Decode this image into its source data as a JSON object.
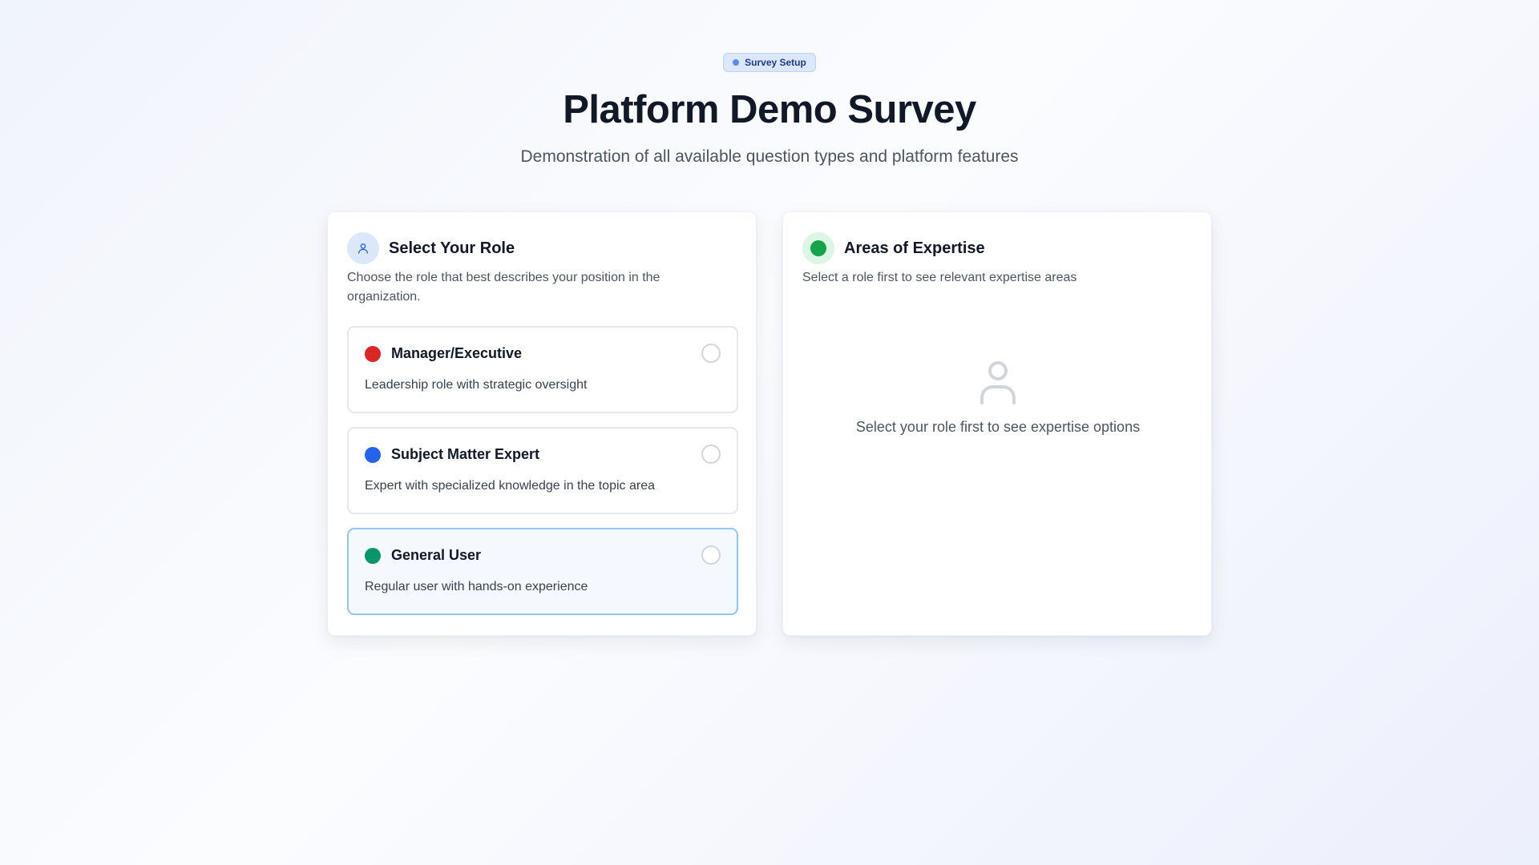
{
  "header": {
    "badge_label": "Survey Setup",
    "title": "Platform Demo Survey",
    "subtitle": "Demonstration of all available question types and platform features"
  },
  "role_card": {
    "icon": "user-icon",
    "title": "Select Your Role",
    "description": "Choose the role that best describes your position in the organization.",
    "options": [
      {
        "label": "Manager/Executive",
        "description": "Leadership role with strategic oversight",
        "color": "#dc2626",
        "selected": false
      },
      {
        "label": "Subject Matter Expert",
        "description": "Expert with specialized knowledge in the topic area",
        "color": "#2563eb",
        "selected": false
      },
      {
        "label": "General User",
        "description": "Regular user with hands-on experience",
        "color": "#059669",
        "selected": false
      }
    ]
  },
  "expertise_card": {
    "icon": "green-dot-icon",
    "title": "Areas of Expertise",
    "description": "Select a role first to see relevant expertise areas",
    "empty_state": {
      "icon": "user-placeholder-icon",
      "text": "Select your role first to see expertise options"
    }
  },
  "colors": {
    "accent_blue": "#2563eb",
    "accent_green": "#16a34a",
    "hover_border": "#93c5fd"
  }
}
